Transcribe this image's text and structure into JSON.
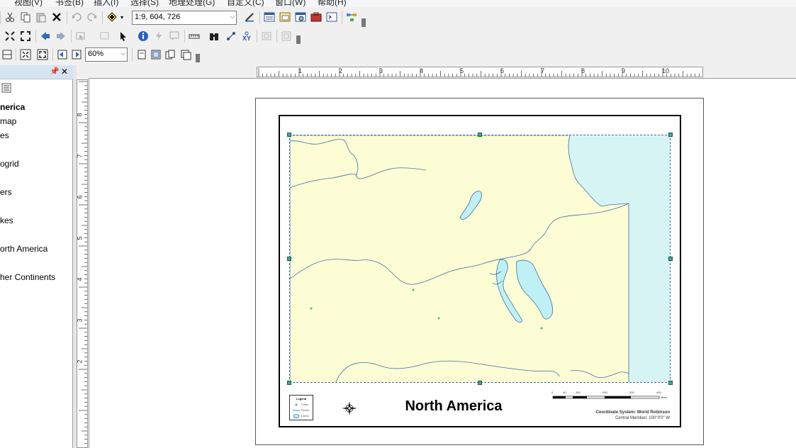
{
  "menubar": {
    "items": [
      "视图(V)",
      "书签(B)",
      "插入(I)",
      "选择(S)",
      "地理处理(G)",
      "自定义(C)",
      "窗口(W)",
      "帮助(H)"
    ]
  },
  "toolbar": {
    "scale_value": "1:9, 604, 726",
    "zoom_value": "60%"
  },
  "toc": {
    "items": [
      {
        "label": "nerica",
        "bold": true
      },
      {
        "label": "map",
        "bold": false
      },
      {
        "label": "es",
        "bold": false
      },
      {
        "label": "ogrid",
        "bold": false
      },
      {
        "label": "ers",
        "bold": false
      },
      {
        "label": "kes",
        "bold": false
      },
      {
        "label": "orth America",
        "bold": false
      },
      {
        "label": "her Continents",
        "bold": false
      }
    ]
  },
  "ruler": {
    "top_labels": [
      "1",
      "2",
      "3",
      "4",
      "5",
      "6",
      "7",
      "8",
      "9",
      "10"
    ],
    "left_labels": [
      "8",
      "7",
      "6",
      "5",
      "4",
      "3",
      "2"
    ]
  },
  "layout": {
    "title": "North America",
    "legend": {
      "title": "Legend",
      "items": [
        "Cities",
        "Rivers",
        "Lakes"
      ]
    },
    "coordinate_system": "Coordinate System: World Robinson",
    "central_meridian": "Central Meridian: 100°0'0\" W",
    "scale_labels": [
      "0",
      "40",
      "100",
      "200",
      "300",
      "400"
    ],
    "scale_unit": "Miles"
  },
  "colors": {
    "land": "#fdfdd5",
    "water": "#d7f4f4",
    "river": "#3d6fa8",
    "lake_fill": "#bff0f5",
    "panel_header": "#d6e4f2"
  }
}
